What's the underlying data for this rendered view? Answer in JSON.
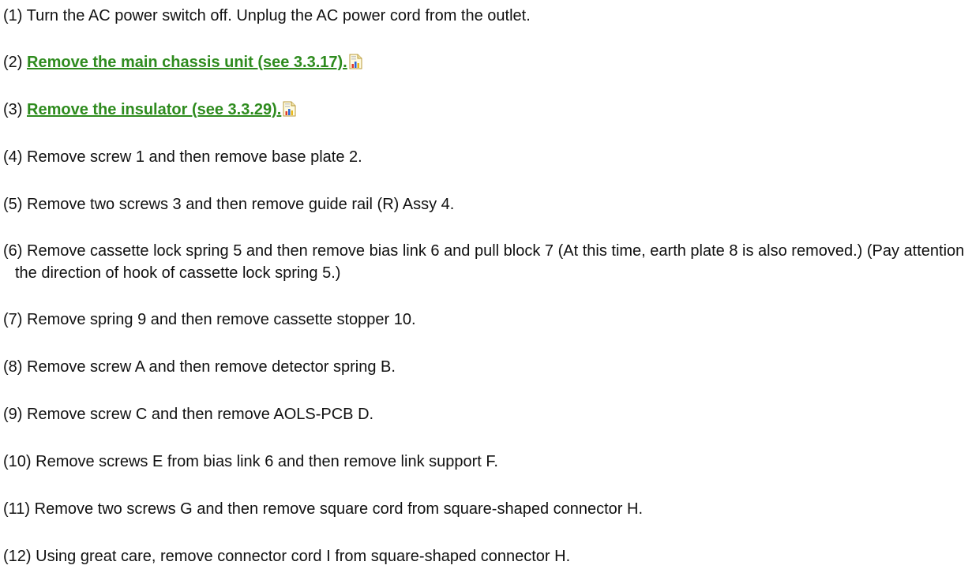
{
  "steps": [
    {
      "num": "(1)",
      "text": "Turn the AC power switch off. Unplug the AC power cord from the outlet."
    },
    {
      "num": "(2)",
      "link": "Remove the main chassis unit (see 3.3.17).",
      "icon": "document-chart-icon"
    },
    {
      "num": "(3)",
      "link": "Remove the insulator (see 3.3.29).",
      "icon": "document-chart-icon"
    },
    {
      "num": "(4)",
      "text": "Remove screw 1 and then remove base plate 2."
    },
    {
      "num": "(5)",
      "text": "Remove two screws 3 and then remove guide rail (R) Assy 4."
    },
    {
      "num": "(6)",
      "text": "Remove cassette lock spring 5 and then remove bias link 6 and pull block 7 (At this time, earth plate 8 is also removed.) (Pay attention the direction of hook of cassette lock spring 5.)"
    },
    {
      "num": "(7)",
      "text": "Remove spring 9 and then remove cassette stopper 10."
    },
    {
      "num": "(8)",
      "text": "Remove screw A and then remove detector spring B."
    },
    {
      "num": "(9)",
      "text": "Remove screw C and then remove AOLS-PCB D."
    },
    {
      "num": "(10)",
      "text": "Remove screws E from bias link 6 and then remove link support F."
    },
    {
      "num": "(11)",
      "text": "Remove two screws G and then remove square cord from square-shaped connector H."
    },
    {
      "num": "(12)",
      "text": "Using great care, remove connector cord I from square-shaped connector H."
    }
  ],
  "colors": {
    "link": "#2e8b1e",
    "text": "#111111",
    "background": "#ffffff"
  }
}
